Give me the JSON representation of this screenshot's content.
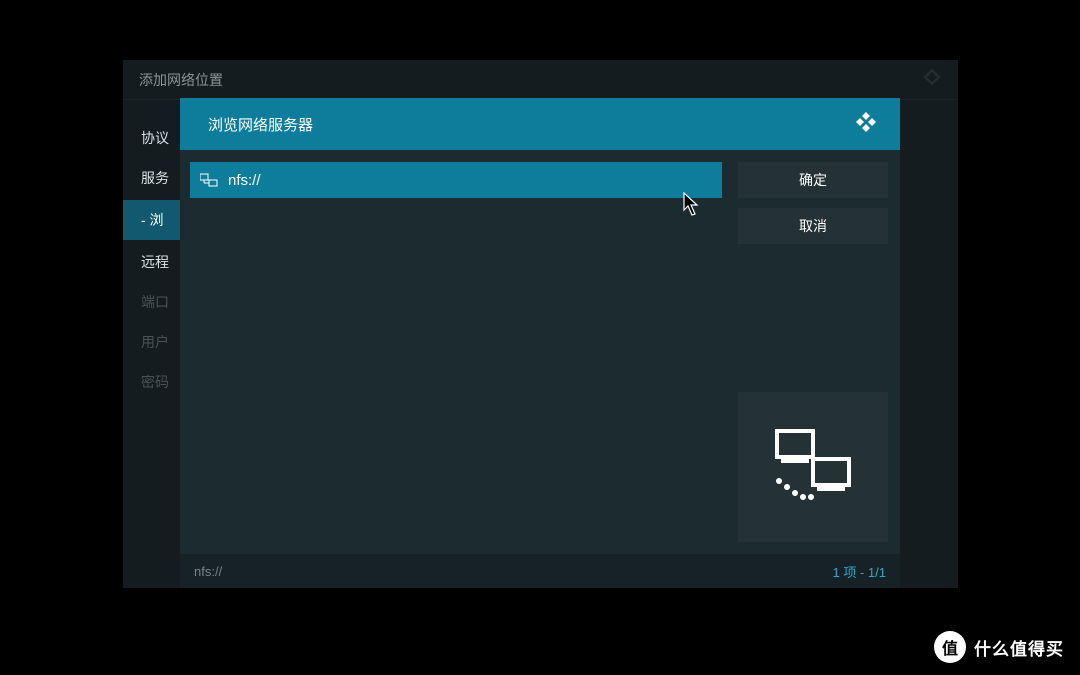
{
  "outer": {
    "title": "添加网络位置",
    "sidebar": [
      {
        "label": "协议",
        "dimmed": false
      },
      {
        "label": "服务",
        "dimmed": false
      },
      {
        "label": "- 浏",
        "active": true
      },
      {
        "label": "远程",
        "dimmed": false
      },
      {
        "label": "端口",
        "dimmed": true
      },
      {
        "label": "用户",
        "dimmed": true
      },
      {
        "label": "密码",
        "dimmed": true
      }
    ]
  },
  "inner": {
    "title": "浏览网络服务器",
    "list": [
      {
        "label": "nfs://"
      }
    ],
    "buttons": {
      "ok": "确定",
      "cancel": "取消"
    },
    "footer": {
      "path": "nfs://",
      "count_label": "1 项",
      "separator": " - ",
      "page": "1/1"
    }
  },
  "watermark": {
    "badge": "值",
    "text": "什么值得买"
  }
}
